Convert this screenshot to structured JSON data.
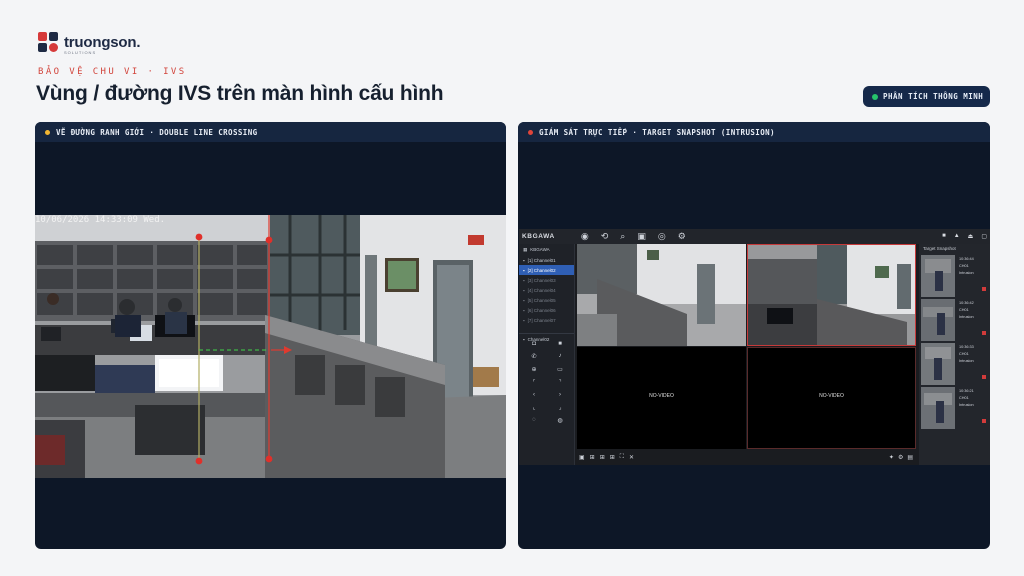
{
  "brand": {
    "name": "truongson.",
    "sub": "SOLUTIONS"
  },
  "kicker": "BẢO VỆ CHU VI · IVS",
  "title": "Vùng / đường IVS trên màn hình cấu hình",
  "badge": {
    "label": "PHÂN TÍCH THÔNG MINH",
    "color": "#26c36b"
  },
  "left_panel": {
    "header": "VẼ ĐƯỜNG RANH GIỚI · DOUBLE LINE CROSSING",
    "dot_color": "#f2b632",
    "timestamp": "10/06/2026 14:33:09 Wed."
  },
  "right_panel": {
    "header": "GIÁM SÁT TRỰC TIẾP · TARGET SNAPSHOT (INTRUSION)",
    "dot_color": "#e0453a",
    "nvr": {
      "brand": "KBGAWA",
      "toolbar_icons": [
        "live-view-icon",
        "playback-icon",
        "search-icon",
        "device-icon",
        "ai-icon",
        "settings-icon"
      ],
      "sidebar": {
        "group": "KBGAWA",
        "channels": [
          {
            "label": "[1] Channel01",
            "state": "normal"
          },
          {
            "label": "[2] Channel02",
            "state": "selected"
          },
          {
            "label": "[3] Channel03",
            "state": "dim"
          },
          {
            "label": "[4] Channel04",
            "state": "dim"
          },
          {
            "label": "[5] Channel05",
            "state": "dim"
          },
          {
            "label": "[6] Channel06",
            "state": "dim"
          },
          {
            "label": "[7] Channel07",
            "state": "dim"
          }
        ],
        "current": "Channel02"
      },
      "tiles": [
        "",
        "",
        "NO-VIDEO",
        "NO-VIDEO"
      ],
      "snapshot": {
        "title": "Target Snapshot",
        "items": [
          {
            "time": "10:36:44",
            "channel": "CH01",
            "event": "Intrusion"
          },
          {
            "time": "10:36:42",
            "channel": "CH01",
            "event": "Intrusion"
          },
          {
            "time": "10:36:33",
            "channel": "CH01",
            "event": "Intrusion"
          },
          {
            "time": "10:36:21",
            "channel": "CH01",
            "event": "Intrusion"
          }
        ]
      }
    }
  }
}
